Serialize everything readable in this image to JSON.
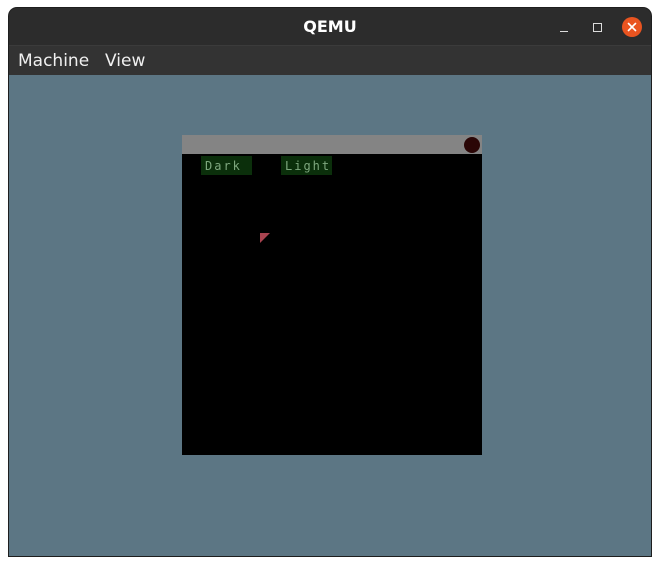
{
  "window": {
    "title": "QEMU"
  },
  "titlebar_buttons": {
    "minimize_icon": "minimize-icon",
    "maximize_icon": "maximize-icon",
    "close_icon": "close-icon",
    "close_color": "#e95420"
  },
  "menubar": {
    "items": [
      {
        "label": "Machine"
      },
      {
        "label": "View"
      }
    ]
  },
  "guest": {
    "background_color": "#5c7684",
    "app": {
      "buttons": [
        {
          "label": "Dark"
        },
        {
          "label": "Light"
        }
      ],
      "close_icon": "close-dot-icon",
      "cursor_icon": "mouse-pointer-icon"
    }
  }
}
